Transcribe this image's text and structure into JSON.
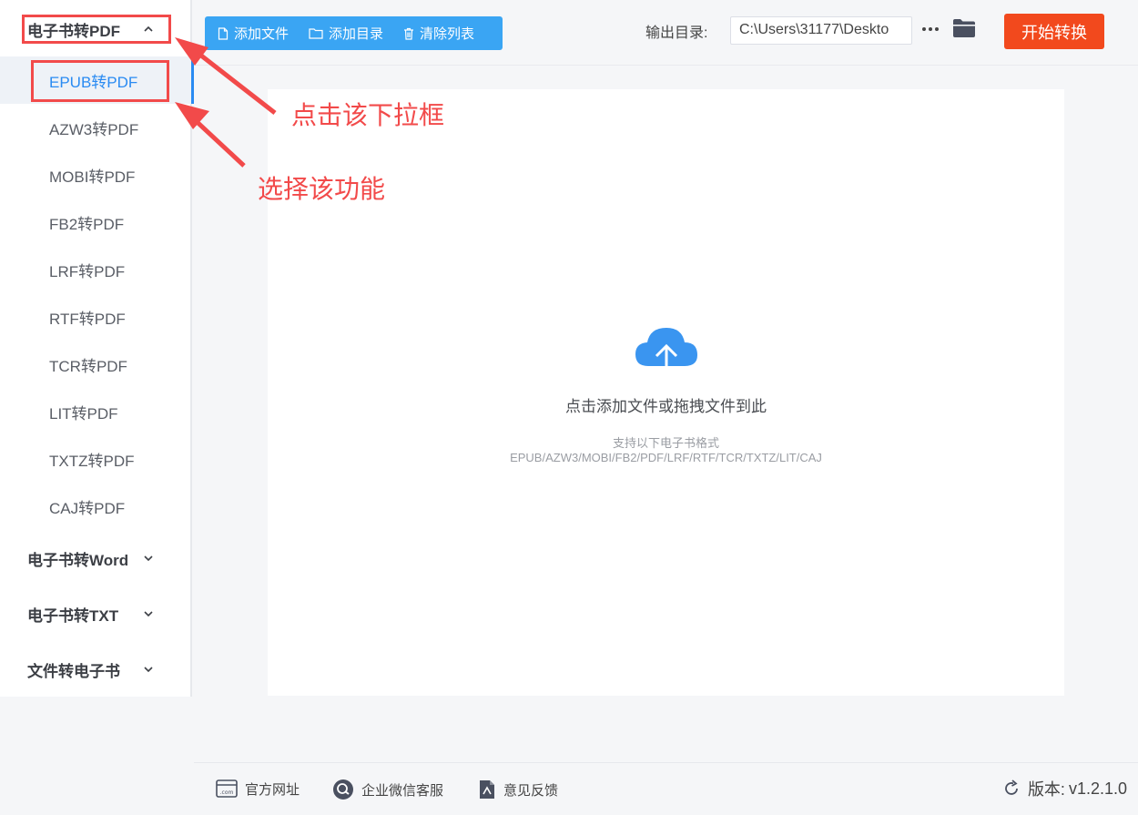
{
  "sidebar": {
    "groups": [
      {
        "label": "电子书转PDF",
        "expanded": true
      },
      {
        "label": "电子书转Word",
        "expanded": false
      },
      {
        "label": "电子书转TXT",
        "expanded": false
      },
      {
        "label": "文件转电子书",
        "expanded": false
      }
    ],
    "pdf_items": [
      {
        "label": "EPUB转PDF",
        "active": true
      },
      {
        "label": "AZW3转PDF"
      },
      {
        "label": "MOBI转PDF"
      },
      {
        "label": "FB2转PDF"
      },
      {
        "label": "LRF转PDF"
      },
      {
        "label": "RTF转PDF"
      },
      {
        "label": "TCR转PDF"
      },
      {
        "label": "LIT转PDF"
      },
      {
        "label": "TXTZ转PDF"
      },
      {
        "label": "CAJ转PDF"
      }
    ]
  },
  "toolbar": {
    "add_file": "添加文件",
    "add_folder": "添加目录",
    "clear_list": "清除列表",
    "output_label": "输出目录:",
    "output_path": "C:\\Users\\31177\\Deskto",
    "more_label": "···",
    "start_label": "开始转换"
  },
  "dropzone": {
    "main_text": "点击添加文件或拖拽文件到此",
    "sub_text": "支持以下电子书格式",
    "formats": "EPUB/AZW3/MOBI/FB2/PDF/LRF/RTF/TCR/TXTZ/LIT/CAJ"
  },
  "annotations": {
    "dropdown_hint": "点击该下拉框",
    "select_hint": "选择该功能"
  },
  "footer": {
    "website": "官方网址",
    "wechat_service": "企业微信客服",
    "feedback": "意见反馈",
    "version_label": "版本:",
    "version_value": "v1.2.1.0"
  },
  "colors": {
    "accent": "#2a8bf2",
    "toolbar_blue": "#3aa5f3",
    "start_orange": "#f2491d",
    "annotation_red": "#f24a4a"
  }
}
